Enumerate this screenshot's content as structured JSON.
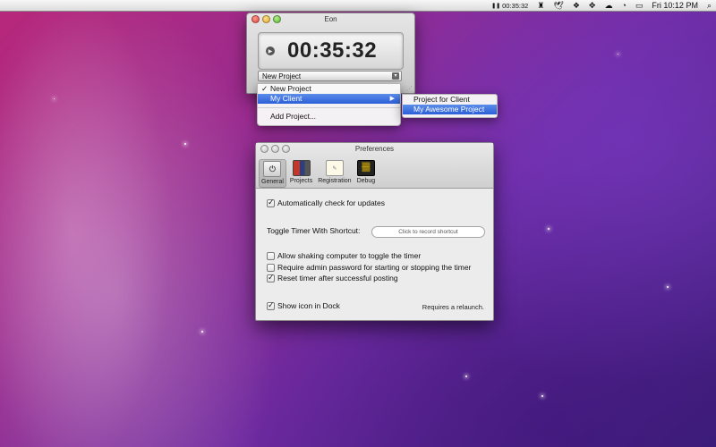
{
  "menubar": {
    "timer": "00:35:32",
    "clock": "Fri 10:12 PM",
    "icons": [
      "eon-timer-icon",
      "bottle-icon",
      "twitter-icon",
      "dropbox-icon",
      "move-icon",
      "cloud-icon",
      "wifi-icon",
      "battery-icon",
      "spotlight-icon"
    ]
  },
  "eon": {
    "title": "Eon",
    "timer": "00:35:32",
    "selected_project": "New Project"
  },
  "dropdown": {
    "items": [
      "New Project",
      "My Client",
      "Add Project..."
    ],
    "submenu": [
      "Project for Client",
      "My Awesome Project"
    ]
  },
  "preferences": {
    "title": "Preferences",
    "tabs": [
      "General",
      "Projects",
      "Registration",
      "Debug"
    ],
    "auto_update": "Automatically check for updates",
    "toggle_label": "Toggle Timer With Shortcut:",
    "shortcut_placeholder": "Click to record shortcut",
    "opt_shake": "Allow shaking computer to toggle the timer",
    "opt_admin": "Require admin password for starting or stopping the timer",
    "opt_reset": "Reset timer after successful posting",
    "opt_dock": "Show icon in Dock",
    "relaunch_note": "Requires a relaunch."
  }
}
